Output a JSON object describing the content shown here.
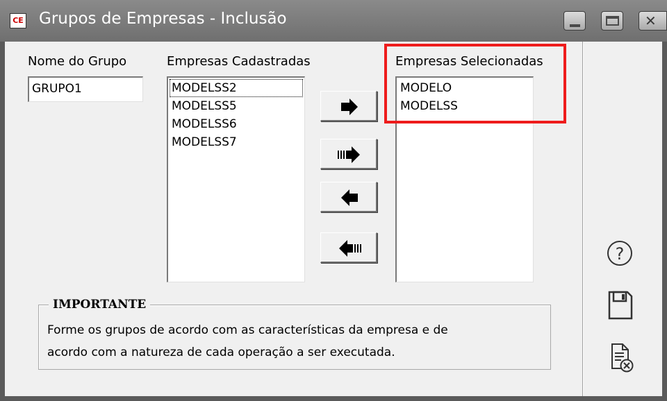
{
  "window": {
    "icon_text": "CE",
    "title": "Grupos de Empresas - Inclusão",
    "controls": [
      "minimize",
      "maximize",
      "close"
    ]
  },
  "form": {
    "group_name_label": "Nome do Grupo",
    "group_name_value": "GRUPO1",
    "available_label": "Empresas Cadastradas",
    "available_items": [
      "MODELSS2",
      "MODELSS5",
      "MODELSS6",
      "MODELSS7"
    ],
    "selected_label": "Empresas Selecionadas",
    "selected_items": [
      "MODELO",
      "MODELSS"
    ]
  },
  "buttons": {
    "add_one": "arrow-right-icon",
    "add_all": "arrow-right-all-icon",
    "remove_one": "arrow-left-icon",
    "remove_all": "arrow-left-all-icon"
  },
  "important": {
    "legend": "IMPORTANTE",
    "line1": "Forme os grupos de acordo com as características da empresa e de",
    "line2": "acordo com a natureza de cada operação a ser executada."
  },
  "side_toolbar": [
    "help-icon",
    "save-icon",
    "cancel-document-icon"
  ],
  "colors": {
    "titlebar": "#7a7a7a",
    "highlight": "#ee1c1c",
    "background": "#f0f0f0"
  }
}
